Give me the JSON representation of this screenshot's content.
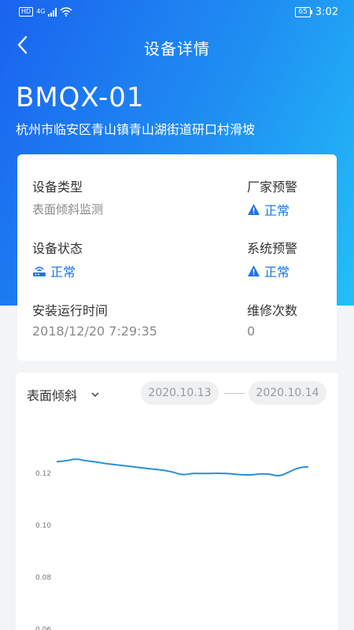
{
  "status_bar": {
    "hd": "HD",
    "network": "4G",
    "battery": "65",
    "time": "3:02"
  },
  "nav": {
    "title": "设备详情"
  },
  "device": {
    "name": "BMQX-01",
    "address": "杭州市临安区青山镇青山湖街道研口村滑坡"
  },
  "info": {
    "type_label": "设备类型",
    "type_value": "表面倾斜监测",
    "vendor_warning_label": "厂家预警",
    "vendor_warning_value": "正常",
    "status_label": "设备状态",
    "status_value": "正常",
    "system_warning_label": "系统预警",
    "system_warning_value": "正常",
    "install_time_label": "安装运行时间",
    "install_time_value": "2018/12/20 7:29:35",
    "repair_label": "维修次数",
    "repair_value": "0"
  },
  "chart_panel": {
    "selector": "表面倾斜",
    "date_from": "2020.10.13",
    "date_to": "2020.10.14"
  },
  "colors": {
    "accent": "#1b74e8",
    "line": "#2b8fd6"
  },
  "chart_data": {
    "type": "line",
    "x": [
      0,
      1,
      2,
      3,
      4,
      5,
      6,
      7,
      8,
      9,
      10,
      11,
      12,
      13,
      14,
      15,
      16,
      17,
      18,
      19,
      20,
      21,
      22,
      23,
      24,
      25,
      26
    ],
    "series": [
      {
        "values": [
          0.1245,
          0.1248,
          0.1256,
          0.1248,
          0.1244,
          0.1238,
          0.1233,
          0.1229,
          0.1225,
          0.122,
          0.1216,
          0.1212,
          0.1205,
          0.1193,
          0.12,
          0.1199,
          0.12,
          0.12,
          0.1198,
          0.1195,
          0.1193,
          0.1198,
          0.1197,
          0.1188,
          0.1205,
          0.1222,
          0.1225
        ]
      }
    ],
    "yticks": [
      "0.12",
      "0.10",
      "0.08",
      "0.06"
    ],
    "ylim": [
      0.06,
      0.127
    ],
    "grid": false
  }
}
